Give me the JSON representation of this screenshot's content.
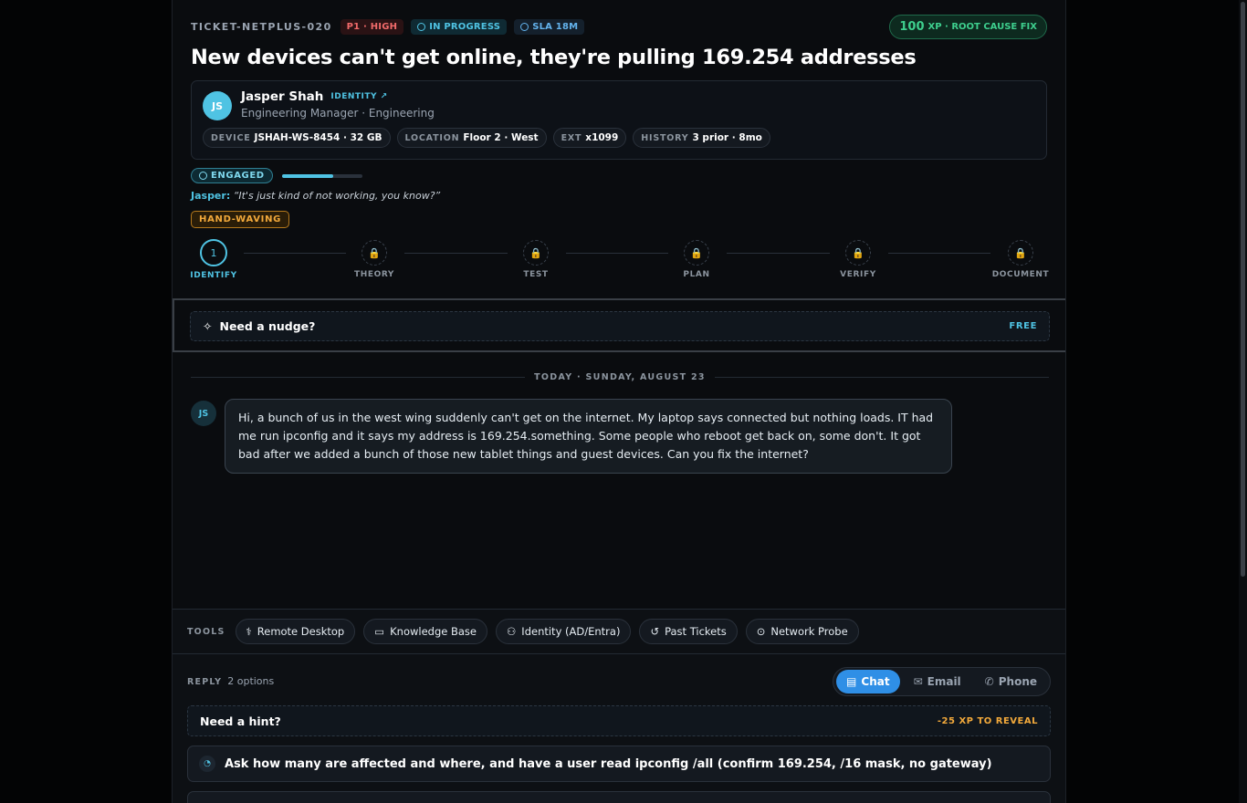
{
  "ticket": {
    "id": "TICKET-NETPLUS-020",
    "priority": "P1 · HIGH",
    "status": "IN PROGRESS",
    "sla": "SLA 18M",
    "xp_value": "100",
    "xp_label": "XP · ROOT CAUSE FIX",
    "title": "New devices can't get online, they're pulling 169.254 addresses"
  },
  "caller": {
    "initials": "JS",
    "name": "Jasper Shah",
    "identity_link": "IDENTITY ↗",
    "role": "Engineering Manager · Engineering",
    "chips": [
      {
        "key": "DEVICE",
        "value": "JSHAH-WS-8454 · 32 GB"
      },
      {
        "key": "LOCATION",
        "value": "Floor 2 · West"
      },
      {
        "key": "EXT",
        "value": "x1099"
      },
      {
        "key": "HISTORY",
        "value": "3 prior · 8mo"
      }
    ],
    "engagement": "ENGAGED",
    "engagement_level": 0.64,
    "quote_speaker": "Jasper:",
    "quote": "“It's just kind of not working, you know?”",
    "trait": "HAND-WAVING"
  },
  "steps": [
    {
      "label": "IDENTIFY",
      "marker": "1",
      "state": "active"
    },
    {
      "label": "THEORY",
      "marker": "🔒",
      "state": "locked"
    },
    {
      "label": "TEST",
      "marker": "🔒",
      "state": "locked"
    },
    {
      "label": "PLAN",
      "marker": "🔒",
      "state": "locked"
    },
    {
      "label": "VERIFY",
      "marker": "🔒",
      "state": "locked"
    },
    {
      "label": "DOCUMENT",
      "marker": "🔒",
      "state": "locked"
    }
  ],
  "nudge": {
    "label": "Need a nudge?",
    "cost": "FREE"
  },
  "chat": {
    "date_divider": "TODAY · SUNDAY, AUGUST 23",
    "message": {
      "initials": "JS",
      "text": "Hi, a bunch of us in the west wing suddenly can't get on the internet. My laptop says connected but nothing loads. IT had me run ipconfig and it says my address is 169.254.something. Some people who reboot get back on, some don't. It got bad after we added a bunch of those new tablet things and guest devices. Can you fix the internet?"
    }
  },
  "tools": {
    "label": "TOOLS",
    "items": [
      {
        "label": "Remote Desktop",
        "icon": "stethoscope-icon"
      },
      {
        "label": "Knowledge Base",
        "icon": "book-icon"
      },
      {
        "label": "Identity (AD/Entra)",
        "icon": "person-icon"
      },
      {
        "label": "Past Tickets",
        "icon": "history-icon"
      },
      {
        "label": "Network Probe",
        "icon": "probe-icon"
      }
    ]
  },
  "reply": {
    "label": "REPLY",
    "count": "2 options",
    "modes": [
      {
        "label": "Chat",
        "active": true
      },
      {
        "label": "Email",
        "active": false
      },
      {
        "label": "Phone",
        "active": false
      }
    ],
    "hint": {
      "label": "Need a hint?",
      "cost": "-25 XP TO REVEAL"
    },
    "options": [
      "Ask how many are affected and where, and have a user read ipconfig /all (confirm 169.254, /16 mask, no gateway)"
    ]
  },
  "colors": {
    "accent": "#4fc3e3",
    "xp": "#3ecf8e",
    "priority": "#f26b6b",
    "warning": "#f2a93b",
    "chat_active": "#2f8fe6"
  }
}
